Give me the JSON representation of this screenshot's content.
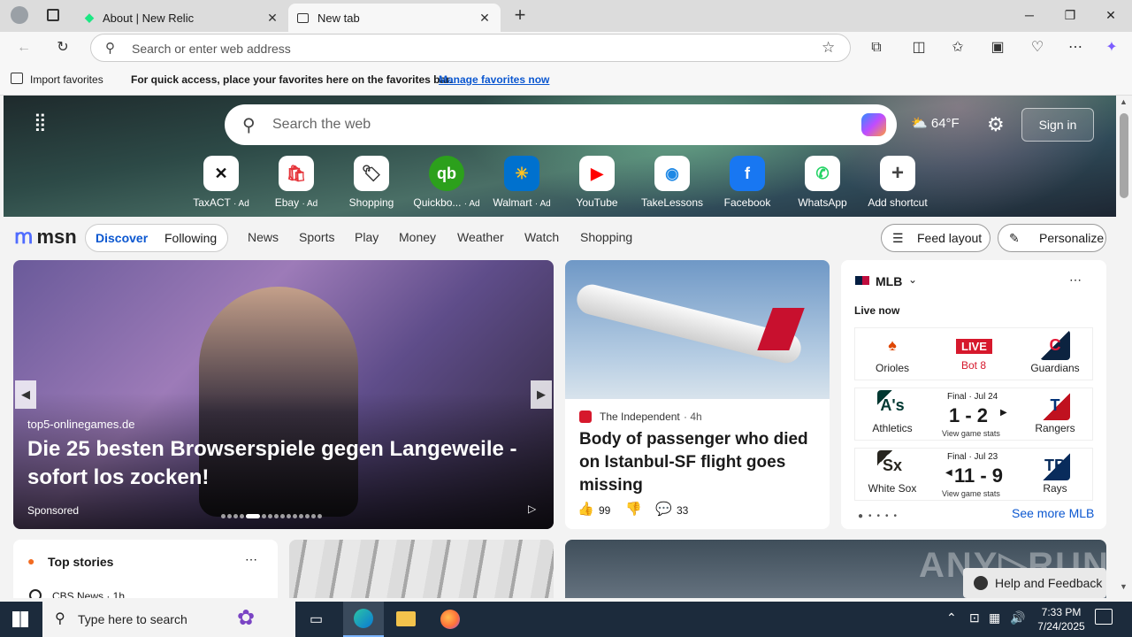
{
  "browser": {
    "tabs": [
      {
        "title": "About | New Relic"
      },
      {
        "title": "New tab"
      }
    ],
    "address_placeholder": "Search or enter web address",
    "favbar": {
      "import": "Import favorites",
      "message": "For quick access, place your favorites here on the favorites bar.",
      "link": "Manage favorites now"
    }
  },
  "hero": {
    "search_placeholder": "Search the web",
    "weather": "64°F",
    "sign_in": "Sign in",
    "shortcuts": [
      {
        "label": "TaxACT",
        "ad": "· Ad",
        "color": "#111111"
      },
      {
        "label": "Ebay",
        "ad": "· Ad",
        "color": "#e53238"
      },
      {
        "label": "Shopping",
        "ad": "",
        "color": "#333333"
      },
      {
        "label": "Quickbo...",
        "ad": "· Ad",
        "color": "#2ca01c"
      },
      {
        "label": "Walmart",
        "ad": "· Ad",
        "color": "#0071ce"
      },
      {
        "label": "YouTube",
        "ad": "",
        "color": "#ff0000"
      },
      {
        "label": "TakeLessons",
        "ad": "",
        "color": "#1e88e5"
      },
      {
        "label": "Facebook",
        "ad": "",
        "color": "#1877f2"
      },
      {
        "label": "WhatsApp",
        "ad": "",
        "color": "#25d366"
      },
      {
        "label": "Add shortcut",
        "ad": "",
        "color": "#ffffff"
      }
    ]
  },
  "msn": {
    "logo": "msn",
    "tabs": [
      "Discover",
      "Following"
    ],
    "nav": [
      "News",
      "Sports",
      "Play",
      "Money",
      "Weather",
      "Watch",
      "Shopping"
    ],
    "feed_layout": "Feed layout",
    "personalize": "Personalize"
  },
  "feature": {
    "source": "top5-onlinegames.de",
    "headline": "Die 25 besten Browserspiele gegen Langeweile - sofort los zocken!",
    "sponsored": "Sponsored"
  },
  "story": {
    "publisher": "The Independent",
    "age": "4h",
    "headline": "Body of passenger who died on Istanbul-SF flight goes missing",
    "likes": "99",
    "comments": "33"
  },
  "mlb": {
    "title": "MLB",
    "live_now": "Live now",
    "see_more": "See more MLB",
    "games": [
      {
        "away": "Orioles",
        "home": "Guardians",
        "status": "LIVE",
        "detail": "Bot 8",
        "score": "",
        "link": ""
      },
      {
        "away": "Athletics",
        "home": "Rangers",
        "status": "Final · Jul 24",
        "detail": "",
        "score": "1 - 2",
        "link": "View game stats"
      },
      {
        "away": "White Sox",
        "home": "Rays",
        "status": "Final · Jul 23",
        "detail": "",
        "score": "11 - 9",
        "link": "View game stats"
      }
    ]
  },
  "bottom": {
    "top_stories": "Top stories",
    "cbs": "CBS News · 1h",
    "help": "Help and Feedback"
  },
  "taskbar": {
    "search": "Type here to search",
    "time": "7:33 PM",
    "date": "7/24/2025"
  }
}
